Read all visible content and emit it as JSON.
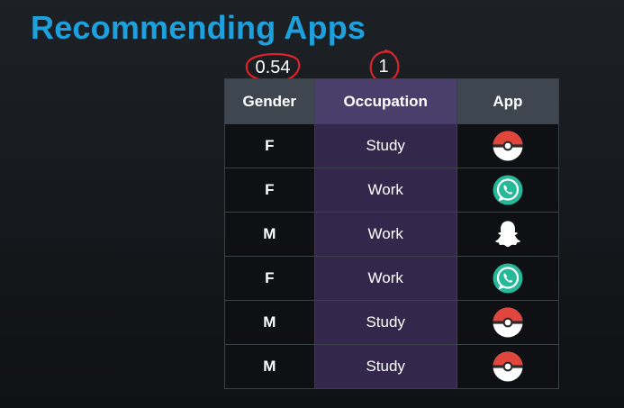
{
  "title": "Recommending Apps",
  "annotations": {
    "left_value": "0.54",
    "right_value": "1",
    "ring_color": "#d8232a"
  },
  "table": {
    "headers": [
      "Gender",
      "Occupation",
      "App"
    ],
    "rows": [
      {
        "gender": "F",
        "occupation": "Study",
        "app": "pokeball-icon"
      },
      {
        "gender": "F",
        "occupation": "Work",
        "app": "whatsapp-icon"
      },
      {
        "gender": "M",
        "occupation": "Work",
        "app": "snapchat-icon"
      },
      {
        "gender": "F",
        "occupation": "Work",
        "app": "whatsapp-icon"
      },
      {
        "gender": "M",
        "occupation": "Study",
        "app": "pokeball-icon"
      },
      {
        "gender": "M",
        "occupation": "Study",
        "app": "pokeball-icon"
      }
    ]
  },
  "colors": {
    "title": "#1ea0dd",
    "header_bg": "#3e4650",
    "occupation_header_bg": "#4a3e6a",
    "occupation_cell_bg": "#33284b",
    "cell_bg": "#0e1013",
    "whatsapp_green": "#25b99a",
    "pokeball_red": "#e2453c"
  }
}
